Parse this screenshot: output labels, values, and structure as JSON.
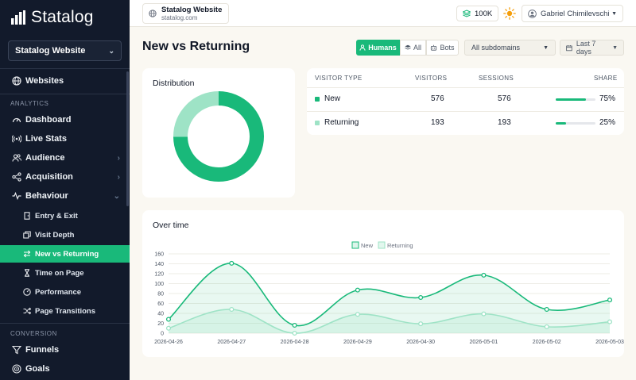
{
  "sidebar": {
    "app_name": "Statalog",
    "site_selector": "Statalog Website",
    "items": {
      "websites": "Websites",
      "analytics_label": "ANALYTICS",
      "dashboard": "Dashboard",
      "live_stats": "Live Stats",
      "audience": "Audience",
      "acquisition": "Acquisition",
      "behaviour": "Behaviour",
      "entry_exit": "Entry & Exit",
      "visit_depth": "Visit Depth",
      "new_vs_returning": "New vs Returning",
      "time_on_page": "Time on Page",
      "performance": "Performance",
      "page_transitions": "Page Transitions",
      "conversion_label": "CONVERSION",
      "funnels": "Funnels",
      "goals": "Goals"
    }
  },
  "topbar": {
    "site_name": "Statalog Website",
    "site_domain": "statalog.com",
    "counter": "100K",
    "user_name": "Gabriel Chimilevschi"
  },
  "header": {
    "title": "New vs Returning",
    "filters": {
      "humans": "Humans",
      "all": "All",
      "bots": "Bots"
    },
    "subdomain": "All subdomains",
    "date_range": "Last 7 days"
  },
  "distribution": {
    "title": "Distribution"
  },
  "table": {
    "headers": {
      "type": "VISITOR TYPE",
      "visitors": "VISITORS",
      "sessions": "SESSIONS",
      "share": "SHARE"
    },
    "rows": [
      {
        "type": "New",
        "visitors": "576",
        "sessions": "576",
        "share": "75%",
        "share_value": 0.75,
        "color": "#19b97a"
      },
      {
        "type": "Returning",
        "visitors": "193",
        "sessions": "193",
        "share": "25%",
        "share_value": 0.25,
        "color": "#9ee3c6"
      }
    ]
  },
  "over_time": {
    "title": "Over time"
  },
  "colors": {
    "accent": "#19b97a",
    "accent_light": "#9ee3c6",
    "sidebar_bg": "#121a2b"
  },
  "chart_data": [
    {
      "type": "pie",
      "title": "Distribution",
      "labels": [
        "New",
        "Returning"
      ],
      "values": [
        576,
        193
      ],
      "donut": true
    },
    {
      "type": "area",
      "title": "Over time",
      "categories": [
        "2026-04-26",
        "2026-04-27",
        "2026-04-28",
        "2026-04-29",
        "2026-04-30",
        "2026-05-01",
        "2026-05-02",
        "2026-05-03"
      ],
      "series": [
        {
          "name": "New",
          "values": [
            28,
            141,
            16,
            87,
            72,
            117,
            48,
            67
          ],
          "color": "#19b97a"
        },
        {
          "name": "Returning",
          "values": [
            10,
            48,
            0,
            38,
            19,
            39,
            13,
            23
          ],
          "color": "#9ee3c6"
        }
      ],
      "ylim": [
        0,
        160
      ],
      "yticks": [
        "0",
        "20",
        "40",
        "60",
        "80",
        "100",
        "120",
        "140",
        "160"
      ],
      "legend": "top-center",
      "grid": true
    }
  ]
}
